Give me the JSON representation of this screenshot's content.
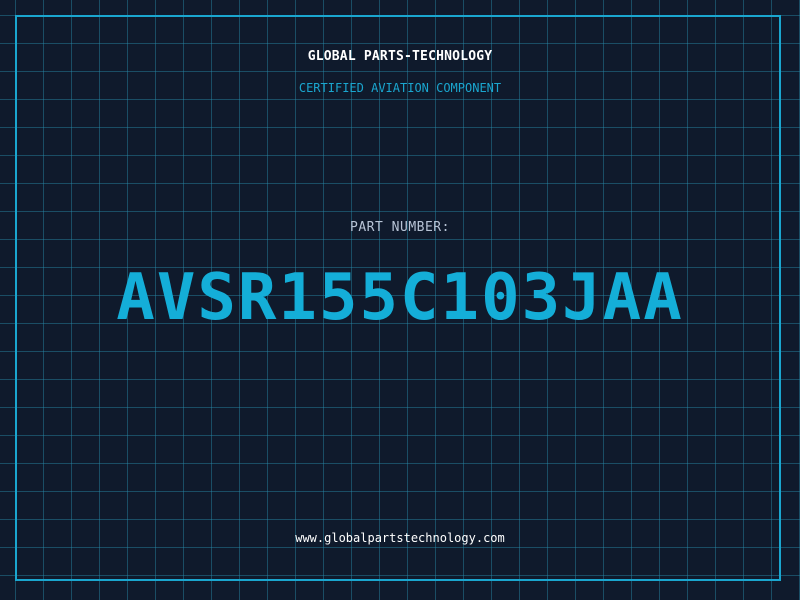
{
  "header": {
    "company": "GLOBAL PARTS-TECHNOLOGY",
    "subtitle": "CERTIFIED AVIATION COMPONENT"
  },
  "part": {
    "label": "PART NUMBER:",
    "number": "AVSR155C103JAA"
  },
  "footer": {
    "website": "www.globalpartstechnology.com"
  },
  "colors": {
    "background": "#0f1a2c",
    "grid": "#288caa",
    "accent": "#1aa6cf",
    "part_number": "#14aed8",
    "label": "#b8c4d6",
    "text": "#ffffff"
  }
}
